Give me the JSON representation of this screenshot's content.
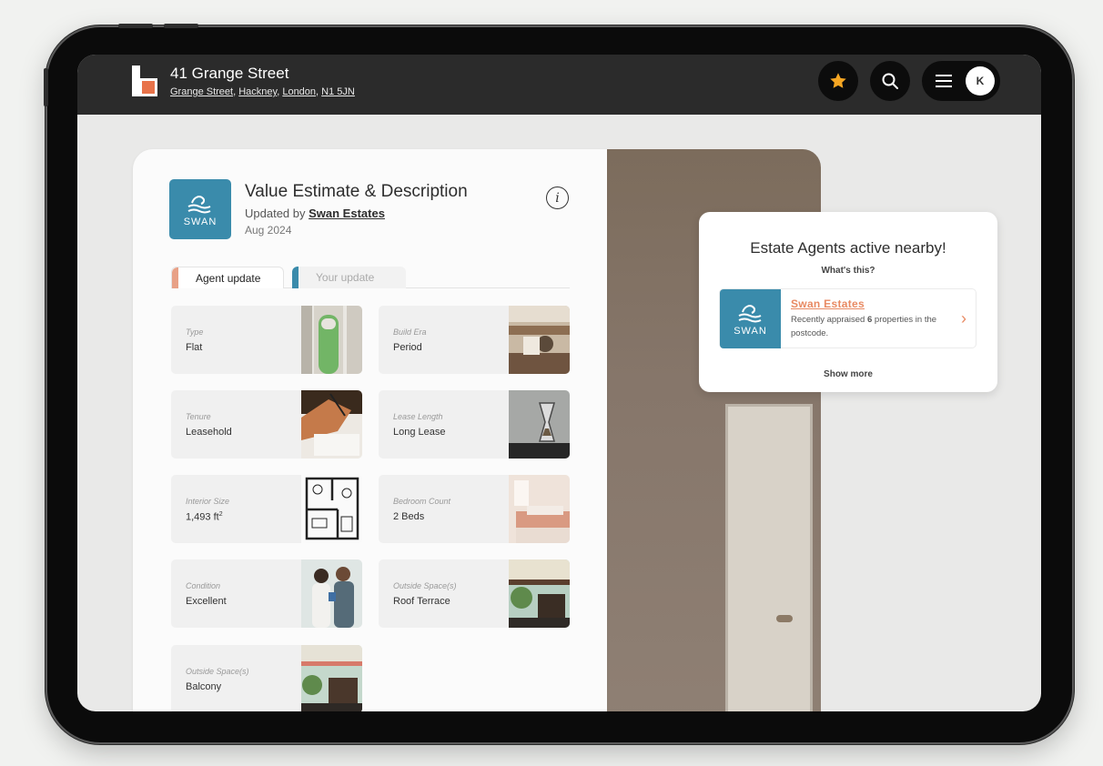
{
  "header": {
    "title": "41 Grange Street",
    "address_parts": [
      "Grange Street",
      "Hackney",
      "London",
      "N1 5JN"
    ],
    "avatar_initial": "K"
  },
  "card": {
    "title": "Value Estimate & Description",
    "updated_prefix": "Updated by ",
    "updated_by": "Swan Estates",
    "date": "Aug 2024",
    "logo_text": "SWAN",
    "tabs": [
      {
        "label": "Agent update",
        "color": "#e8a187",
        "active": true
      },
      {
        "label": "Your update",
        "color": "#3a8bab",
        "active": false
      }
    ],
    "tiles": [
      {
        "label": "Type",
        "value": "Flat",
        "icon": "green-door-photo"
      },
      {
        "label": "Build Era",
        "value": "Period",
        "icon": "period-interior-photo"
      },
      {
        "label": "Tenure",
        "value": "Leasehold",
        "icon": "signing-document-photo"
      },
      {
        "label": "Lease Length",
        "value": "Long Lease",
        "icon": "hourglass-photo"
      },
      {
        "label": "Interior Size",
        "value": "1,493 ft",
        "value_sup": "2",
        "icon": "floorplan-photo"
      },
      {
        "label": "Bedroom Count",
        "value": "2 Beds",
        "icon": "bedroom-photo"
      },
      {
        "label": "Condition",
        "value": "Excellent",
        "icon": "happy-couple-photo"
      },
      {
        "label": "Outside Space(s)",
        "value": "Roof Terrace",
        "icon": "roof-terrace-photo"
      },
      {
        "label": "Outside Space(s)",
        "value": "Balcony",
        "icon": "balcony-photo"
      }
    ]
  },
  "popup": {
    "title": "Estate Agents active nearby!",
    "subtitle": "What's this?",
    "agent_name": "Swan Estates",
    "agent_desc_prefix": "Recently appraised ",
    "agent_count": "6",
    "agent_desc_suffix": " properties in the postcode.",
    "logo_text": "SWAN",
    "show_more": "Show more"
  },
  "colors": {
    "brand_orange": "#e8734a",
    "swan_blue": "#3a8bab",
    "star": "#f5a623",
    "agent_link": "#e88a63"
  }
}
